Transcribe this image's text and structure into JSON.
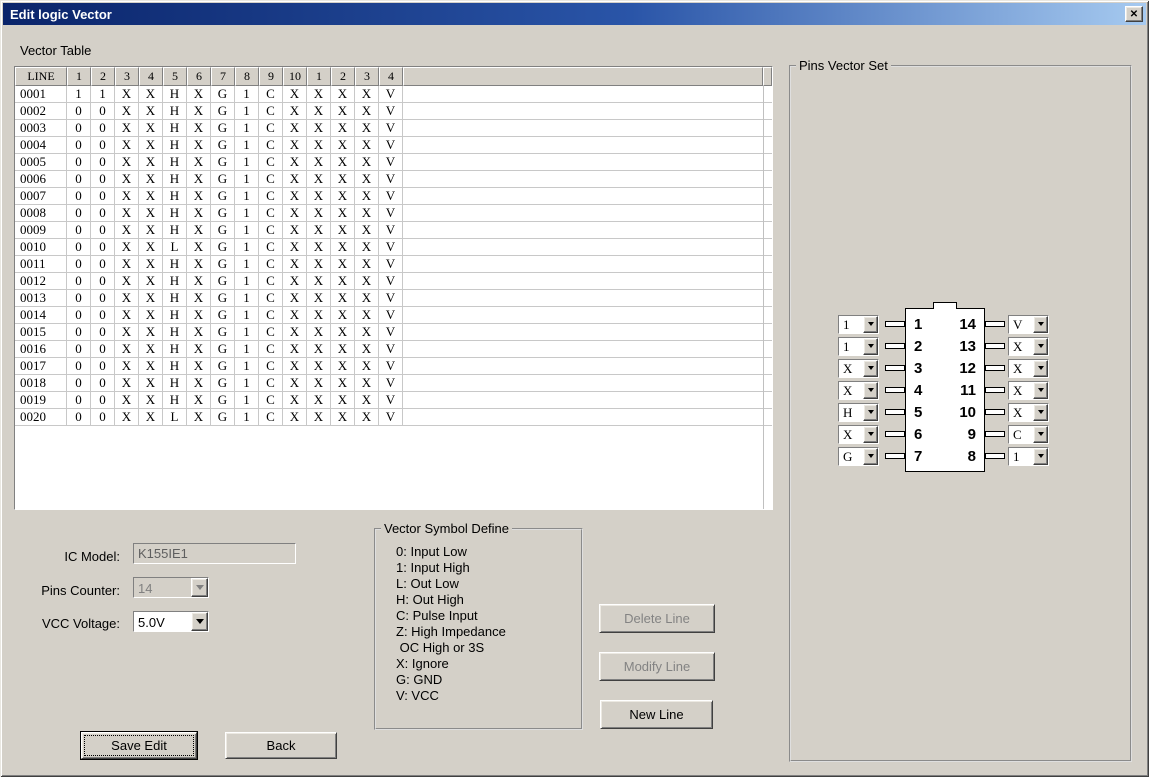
{
  "window": {
    "title": "Edit logic Vector",
    "close_glyph": "✕"
  },
  "colors": {
    "dialog_bg": "#d4d0c8",
    "titlebar_start": "#0a246a",
    "titlebar_end": "#a6caf0",
    "grid_line": "#c8c8c8",
    "disabled_text": "#808080"
  },
  "vector_table": {
    "label": "Vector Table",
    "headers": [
      "LINE",
      "1",
      "2",
      "3",
      "4",
      "5",
      "6",
      "7",
      "8",
      "9",
      "10",
      "1",
      "2",
      "3",
      "4"
    ],
    "rows": [
      {
        "line": "0001",
        "values": [
          "1",
          "1",
          "X",
          "X",
          "H",
          "X",
          "G",
          "1",
          "C",
          "X",
          "X",
          "X",
          "X",
          "V"
        ]
      },
      {
        "line": "0002",
        "values": [
          "0",
          "0",
          "X",
          "X",
          "H",
          "X",
          "G",
          "1",
          "C",
          "X",
          "X",
          "X",
          "X",
          "V"
        ]
      },
      {
        "line": "0003",
        "values": [
          "0",
          "0",
          "X",
          "X",
          "H",
          "X",
          "G",
          "1",
          "C",
          "X",
          "X",
          "X",
          "X",
          "V"
        ]
      },
      {
        "line": "0004",
        "values": [
          "0",
          "0",
          "X",
          "X",
          "H",
          "X",
          "G",
          "1",
          "C",
          "X",
          "X",
          "X",
          "X",
          "V"
        ]
      },
      {
        "line": "0005",
        "values": [
          "0",
          "0",
          "X",
          "X",
          "H",
          "X",
          "G",
          "1",
          "C",
          "X",
          "X",
          "X",
          "X",
          "V"
        ]
      },
      {
        "line": "0006",
        "values": [
          "0",
          "0",
          "X",
          "X",
          "H",
          "X",
          "G",
          "1",
          "C",
          "X",
          "X",
          "X",
          "X",
          "V"
        ]
      },
      {
        "line": "0007",
        "values": [
          "0",
          "0",
          "X",
          "X",
          "H",
          "X",
          "G",
          "1",
          "C",
          "X",
          "X",
          "X",
          "X",
          "V"
        ]
      },
      {
        "line": "0008",
        "values": [
          "0",
          "0",
          "X",
          "X",
          "H",
          "X",
          "G",
          "1",
          "C",
          "X",
          "X",
          "X",
          "X",
          "V"
        ]
      },
      {
        "line": "0009",
        "values": [
          "0",
          "0",
          "X",
          "X",
          "H",
          "X",
          "G",
          "1",
          "C",
          "X",
          "X",
          "X",
          "X",
          "V"
        ]
      },
      {
        "line": "0010",
        "values": [
          "0",
          "0",
          "X",
          "X",
          "L",
          "X",
          "G",
          "1",
          "C",
          "X",
          "X",
          "X",
          "X",
          "V"
        ]
      },
      {
        "line": "0011",
        "values": [
          "0",
          "0",
          "X",
          "X",
          "H",
          "X",
          "G",
          "1",
          "C",
          "X",
          "X",
          "X",
          "X",
          "V"
        ]
      },
      {
        "line": "0012",
        "values": [
          "0",
          "0",
          "X",
          "X",
          "H",
          "X",
          "G",
          "1",
          "C",
          "X",
          "X",
          "X",
          "X",
          "V"
        ]
      },
      {
        "line": "0013",
        "values": [
          "0",
          "0",
          "X",
          "X",
          "H",
          "X",
          "G",
          "1",
          "C",
          "X",
          "X",
          "X",
          "X",
          "V"
        ]
      },
      {
        "line": "0014",
        "values": [
          "0",
          "0",
          "X",
          "X",
          "H",
          "X",
          "G",
          "1",
          "C",
          "X",
          "X",
          "X",
          "X",
          "V"
        ]
      },
      {
        "line": "0015",
        "values": [
          "0",
          "0",
          "X",
          "X",
          "H",
          "X",
          "G",
          "1",
          "C",
          "X",
          "X",
          "X",
          "X",
          "V"
        ]
      },
      {
        "line": "0016",
        "values": [
          "0",
          "0",
          "X",
          "X",
          "H",
          "X",
          "G",
          "1",
          "C",
          "X",
          "X",
          "X",
          "X",
          "V"
        ]
      },
      {
        "line": "0017",
        "values": [
          "0",
          "0",
          "X",
          "X",
          "H",
          "X",
          "G",
          "1",
          "C",
          "X",
          "X",
          "X",
          "X",
          "V"
        ]
      },
      {
        "line": "0018",
        "values": [
          "0",
          "0",
          "X",
          "X",
          "H",
          "X",
          "G",
          "1",
          "C",
          "X",
          "X",
          "X",
          "X",
          "V"
        ]
      },
      {
        "line": "0019",
        "values": [
          "0",
          "0",
          "X",
          "X",
          "H",
          "X",
          "G",
          "1",
          "C",
          "X",
          "X",
          "X",
          "X",
          "V"
        ]
      },
      {
        "line": "0020",
        "values": [
          "0",
          "0",
          "X",
          "X",
          "L",
          "X",
          "G",
          "1",
          "C",
          "X",
          "X",
          "X",
          "X",
          "V"
        ]
      }
    ]
  },
  "ic_settings": {
    "ic_model_label": "IC Model:",
    "ic_model_value": "K155IE1",
    "pins_counter_label": "Pins Counter:",
    "pins_counter_value": "14",
    "vcc_voltage_label": "VCC Voltage:",
    "vcc_voltage_value": "5.0V"
  },
  "symbol_define": {
    "title": "Vector Symbol Define",
    "items": [
      "0: Input Low",
      "1: Input High",
      "L: Out Low",
      "H: Out High",
      "C: Pulse Input",
      "Z: High Impedance",
      " OC High or 3S",
      "X: Ignore",
      "G: GND",
      "V: VCC"
    ]
  },
  "actions": {
    "delete_line": "Delete Line",
    "modify_line": "Modify Line",
    "new_line": "New Line",
    "save_edit": "Save Edit",
    "back": "Back"
  },
  "pins_vector_set": {
    "title": "Pins Vector Set",
    "left_pins": [
      {
        "pin": "1",
        "value": "1"
      },
      {
        "pin": "2",
        "value": "1"
      },
      {
        "pin": "3",
        "value": "X"
      },
      {
        "pin": "4",
        "value": "X"
      },
      {
        "pin": "5",
        "value": "H"
      },
      {
        "pin": "6",
        "value": "X"
      },
      {
        "pin": "7",
        "value": "G"
      }
    ],
    "right_pins": [
      {
        "pin": "14",
        "value": "V"
      },
      {
        "pin": "13",
        "value": "X"
      },
      {
        "pin": "12",
        "value": "X"
      },
      {
        "pin": "11",
        "value": "X"
      },
      {
        "pin": "10",
        "value": "X"
      },
      {
        "pin": "9",
        "value": "C"
      },
      {
        "pin": "8",
        "value": "1"
      }
    ]
  }
}
